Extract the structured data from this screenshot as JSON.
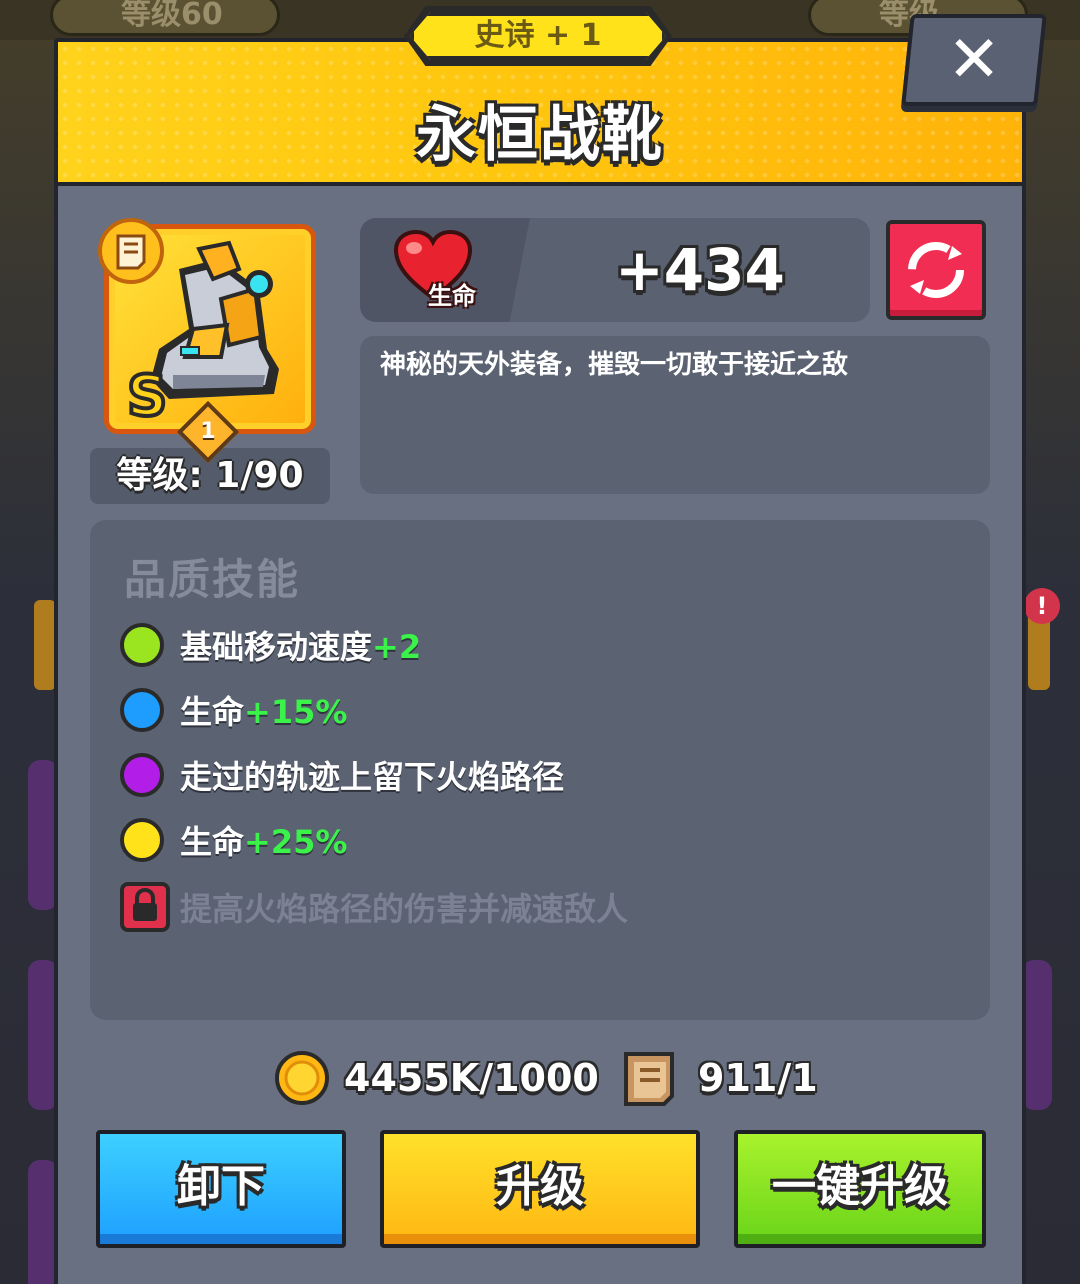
{
  "background": {
    "left_pill_text": "等级60",
    "right_pill_text": "等级"
  },
  "item": {
    "rarity": "史诗 + 1",
    "name": "永恒战靴",
    "grade": "S",
    "star_level": "1",
    "level_text": "等级: 1/90",
    "icon": "boots-icon"
  },
  "stat": {
    "label": "生命",
    "icon": "heart-icon",
    "value": "+434"
  },
  "description": "神秘的天外装备，摧毁一切敢于接近之敌",
  "skills": {
    "title": "品质技能",
    "items": [
      {
        "text": "基础移动速度",
        "bonus": "+2",
        "color": "#9ae51f",
        "locked": false
      },
      {
        "text": "生命",
        "bonus": "+15%",
        "color": "#1e9dff",
        "locked": false
      },
      {
        "text": "走过的轨迹上留下火焰路径",
        "bonus": "",
        "color": "#b21ee8",
        "locked": false
      },
      {
        "text": "生命",
        "bonus": "+25%",
        "color": "#ffe21a",
        "locked": false
      },
      {
        "text": "提高火焰路径的伤害并减速敌人",
        "bonus": "",
        "color": "#e0304c",
        "locked": true
      }
    ]
  },
  "resources": {
    "gold": "4455K/1000",
    "scroll": "911/1"
  },
  "buttons": {
    "unequip": "卸下",
    "upgrade": "升级",
    "upgrade_all": "一键升级"
  },
  "colors": {
    "header": "#ffc60e",
    "panel": "#687082",
    "refresh": "#f22d54",
    "bonus_text": "#3bf24a"
  }
}
